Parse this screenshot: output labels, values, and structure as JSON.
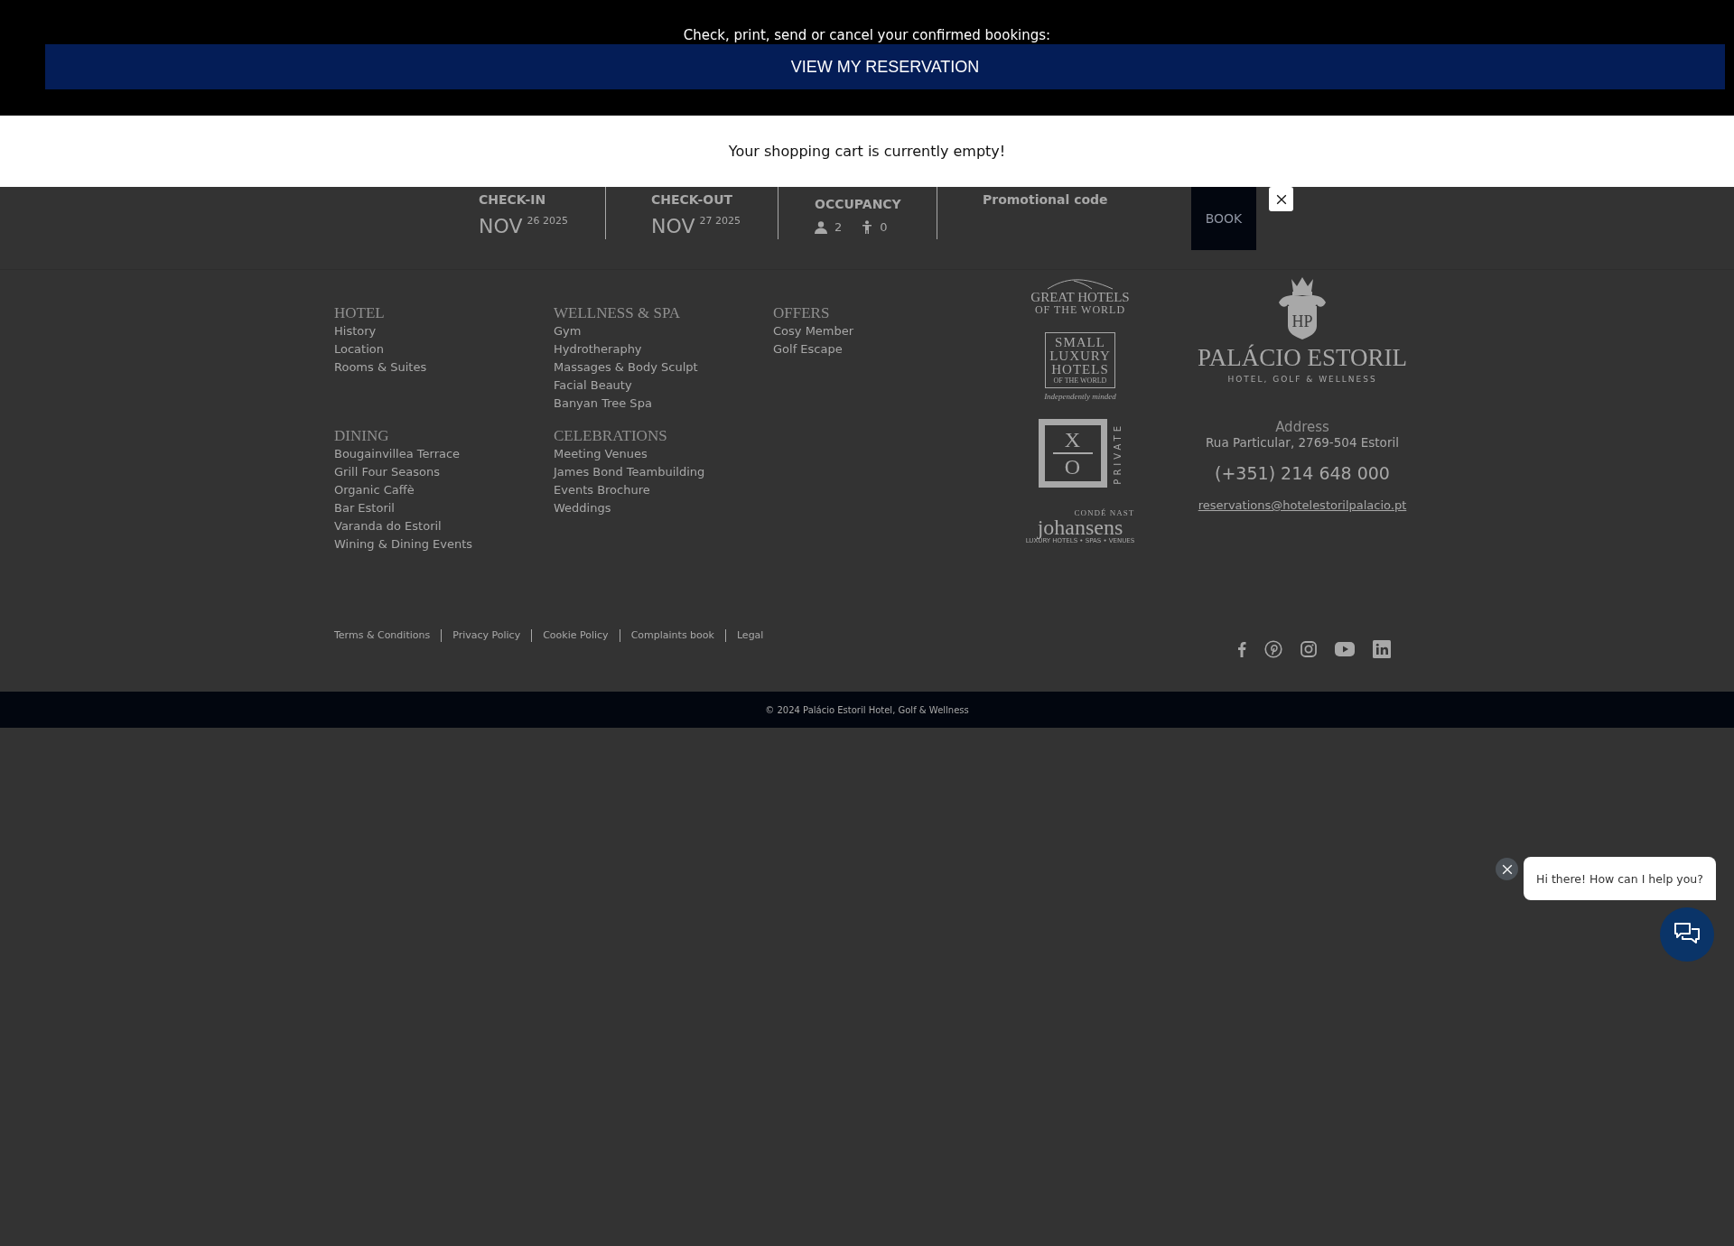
{
  "reservation_bar": {
    "prompt": "Check, print, send or cancel your confirmed bookings:",
    "button": "VIEW MY RESERVATION"
  },
  "cart": {
    "message": "Your shopping cart is currently empty!"
  },
  "booking": {
    "check_in": {
      "label": "CHECK-IN",
      "month": "NOV",
      "day_year": "26 2025"
    },
    "check_out": {
      "label": "CHECK-OUT",
      "month": "NOV",
      "day_year": "27 2025"
    },
    "occupancy": {
      "label": "OCCUPANCY",
      "adults": "2",
      "children": "0"
    },
    "promo": {
      "label": "Promotional code"
    },
    "book_button": "BOOK"
  },
  "footer": {
    "groups": [
      {
        "heading": "HOTEL",
        "links": [
          "History",
          "Location",
          "Rooms & Suites"
        ]
      },
      {
        "heading": "WELLNESS & SPA",
        "links": [
          "Gym",
          "Hydrotheraphy",
          "Massages & Body Sculpt",
          "Facial Beauty",
          "Banyan Tree Spa"
        ]
      },
      {
        "heading": "OFFERS",
        "links": [
          "Cosy Member",
          "Golf Escape"
        ]
      },
      {
        "heading": "DINING",
        "links": [
          "Bougainvillea Terrace",
          "Grill Four Seasons",
          "Organic Caffè",
          "Bar Estoril",
          "Varanda do Estoril",
          "Wining & Dining Events"
        ]
      },
      {
        "heading": "CELEBRATIONS",
        "links": [
          "Meeting Venues",
          "James Bond Teambuilding",
          "Events Brochure",
          "Weddings"
        ]
      }
    ],
    "logos": [
      {
        "kind": "great_hotels",
        "lines": [
          "GREAT HOTELS",
          "OF THE WORLD"
        ]
      },
      {
        "kind": "slh",
        "lines": [
          "SMALL",
          "LUXURY",
          "HOTELS",
          "OF THE WORLD"
        ],
        "tagline": "Independently minded"
      },
      {
        "kind": "xo",
        "lines": [
          "X",
          "O"
        ],
        "tagline": "PRIVATE"
      },
      {
        "kind": "conde_nast",
        "lines": [
          "CONDÉ NAST",
          "johansens"
        ],
        "tagline": "LUXURY HOTELS • SPAS • VENUES"
      }
    ],
    "brand": {
      "monogram": "HP",
      "name": "PALÁCIO ESTORIL",
      "tagline": "HOTEL, GOLF & WELLNESS"
    },
    "contact": {
      "address_label": "Address",
      "address": "Rua Particular, 2769-504 Estoril",
      "phone": "(+351) 214 648 000",
      "email": "reservations@hotelestorilpalacio.pt"
    },
    "legal_links": [
      "Terms & Conditions",
      "Privacy Policy",
      "Cookie Policy",
      "Complaints book",
      "Legal"
    ],
    "social": [
      {
        "kind": "facebook"
      },
      {
        "kind": "pinterest"
      },
      {
        "kind": "instagram"
      },
      {
        "kind": "youtube"
      },
      {
        "kind": "linkedin"
      }
    ],
    "copyright": "© 2024 Palácio Estoril Hotel, Golf & Wellness"
  },
  "chat": {
    "message": "Hi there! How can I help you?"
  }
}
